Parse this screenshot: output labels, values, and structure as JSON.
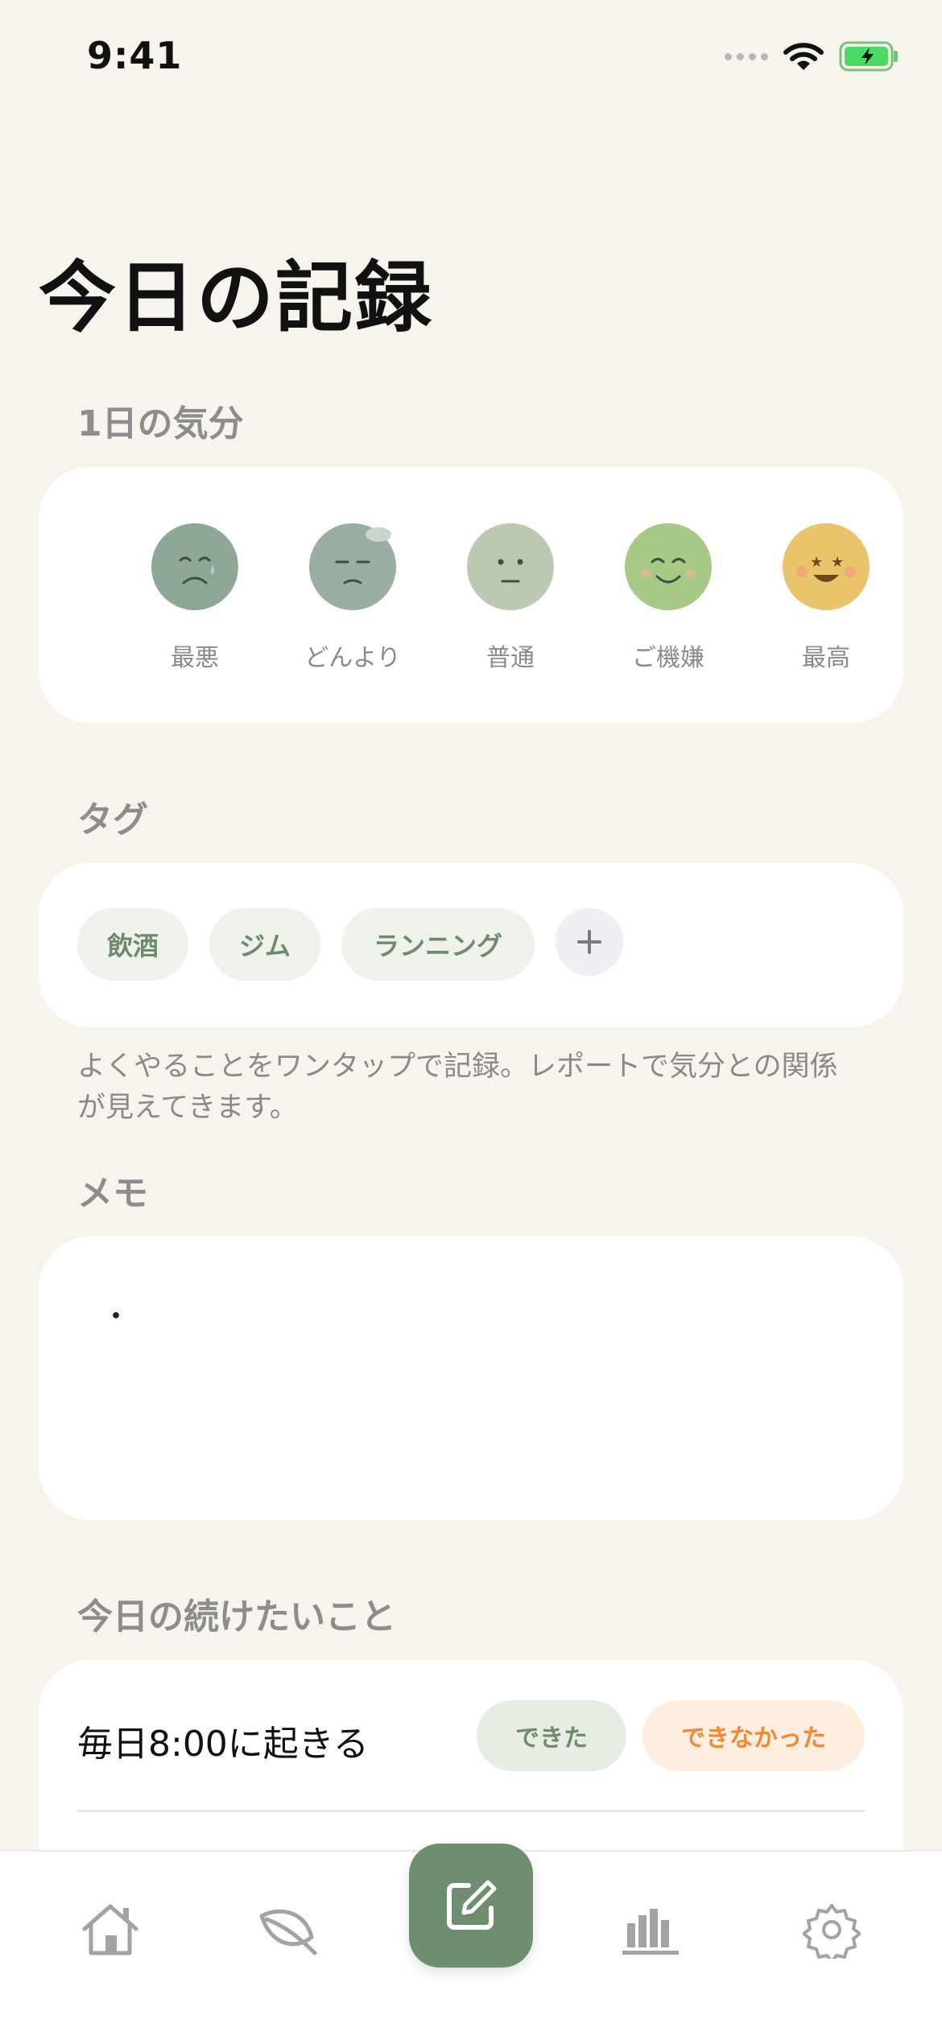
{
  "status_bar": {
    "time": "9:41",
    "battery_color": "#4CD964"
  },
  "page": {
    "title": "今日の記録"
  },
  "mood_section": {
    "label": "1日の気分",
    "moods": [
      {
        "label": "最悪",
        "icon": "mood-worst-face-icon",
        "color": "#8FA796"
      },
      {
        "label": "どんより",
        "icon": "mood-gloomy-face-icon",
        "color": "#9AAEA2"
      },
      {
        "label": "普通",
        "icon": "mood-normal-face-icon",
        "color": "#BCC9B2"
      },
      {
        "label": "ご機嫌",
        "icon": "mood-good-face-icon",
        "color": "#A8C885"
      },
      {
        "label": "最高",
        "icon": "mood-best-face-icon",
        "color": "#E9C46A"
      }
    ]
  },
  "tag_section": {
    "label": "タグ",
    "tags": [
      "飲酒",
      "ジム",
      "ランニング"
    ],
    "add_icon": "plus-icon",
    "help_text": "よくやることをワンタップで記録。レポートで気分との関係が見えてきます。"
  },
  "memo_section": {
    "label": "メモ",
    "value": "・"
  },
  "habit_section": {
    "label": "今日の続けたいこと",
    "items": [
      {
        "title": "毎日8:00に起きる",
        "done_label": "できた",
        "not_done_label": "できなかった"
      }
    ]
  },
  "tab_bar": {
    "tabs": [
      "home-icon",
      "leaf-icon",
      "edit-icon",
      "chart-icon",
      "gear-icon"
    ],
    "accent": "#6E8E6F"
  }
}
